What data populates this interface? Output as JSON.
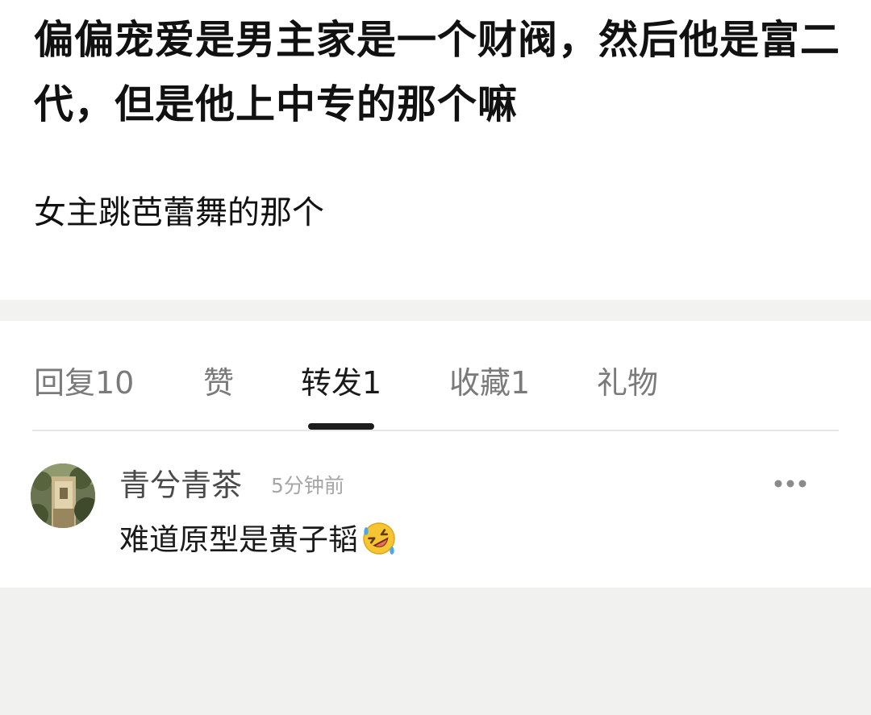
{
  "post": {
    "title": "偏偏宠爱是男主家是一个财阀，然后他是富二代，但是他上中专的那个嘛",
    "body": "女主跳芭蕾舞的那个"
  },
  "tabs": [
    {
      "label": "回复10",
      "active": false
    },
    {
      "label": "赞",
      "active": false
    },
    {
      "label": "转发1",
      "active": true
    },
    {
      "label": "收藏1",
      "active": false
    },
    {
      "label": "礼物",
      "active": false
    }
  ],
  "comment": {
    "author": "青兮青茶",
    "time": "5分钟前",
    "text": "难道原型是黄子韬",
    "emoji": "rolling-on-floor-laughing-emoji",
    "more_icon": "more-dots-icon"
  },
  "colors": {
    "active_tab": "#1a1a1a",
    "inactive_tab": "#7a7a7a",
    "indicator": "#1c1c1c",
    "timestamp": "#a6a6a6",
    "author": "#4a4a4a",
    "page_background": "#f4f4f2"
  }
}
